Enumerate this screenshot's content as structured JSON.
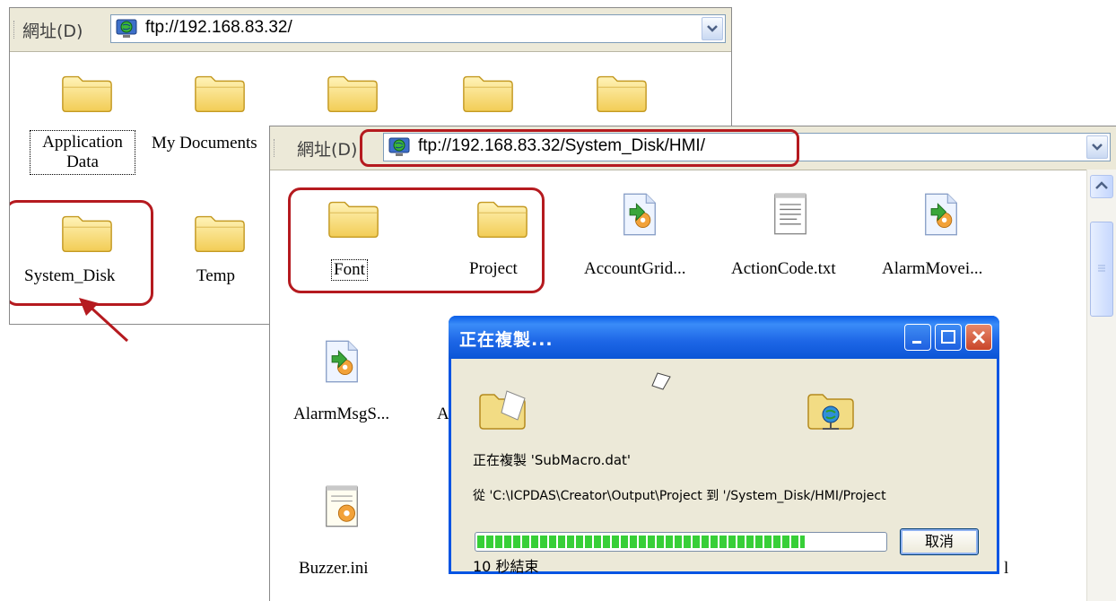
{
  "back_window": {
    "address_label": "網址(D)",
    "url": "ftp://192.168.83.32/",
    "items": [
      {
        "label": "Application Data",
        "focused": true
      },
      {
        "label": "My Documents"
      },
      {
        "label": "System_Disk",
        "highlighted": true
      },
      {
        "label": "Temp"
      }
    ]
  },
  "front_window": {
    "address_label": "網址(D)",
    "url": "ftp://192.168.83.32/System_Disk/HMI/",
    "items": [
      {
        "label": "Font",
        "type": "folder",
        "focused": true
      },
      {
        "label": "Project",
        "type": "folder"
      },
      {
        "label": "AccountGrid...",
        "type": "macro-file"
      },
      {
        "label": "ActionCode.txt",
        "type": "text-file"
      },
      {
        "label": "AlarmMovei...",
        "type": "macro-file"
      },
      {
        "label": "AlarmMsgS...",
        "type": "macro-file"
      },
      {
        "label": "A",
        "type": "macro-file"
      },
      {
        "label": "Buzzer.ini",
        "type": "ini-file"
      },
      {
        "label": "l",
        "type": "file"
      }
    ]
  },
  "copy_dialog": {
    "title": "正在複製...",
    "copying_text": "正在複製 'SubMacro.dat'",
    "from_to_text": "從 'C:\\ICPDAS\\Creator\\Output\\Project 到 '/System_Disk/HMI/Project",
    "progress": 0.8,
    "time_remaining": "10 秒結束",
    "cancel_label": "取消"
  },
  "colors": {
    "highlight_red": "#b51a1f",
    "xp_blue": "#0054e3",
    "progress_green": "#37cf37",
    "folder_yellow": "#f7d76d"
  }
}
